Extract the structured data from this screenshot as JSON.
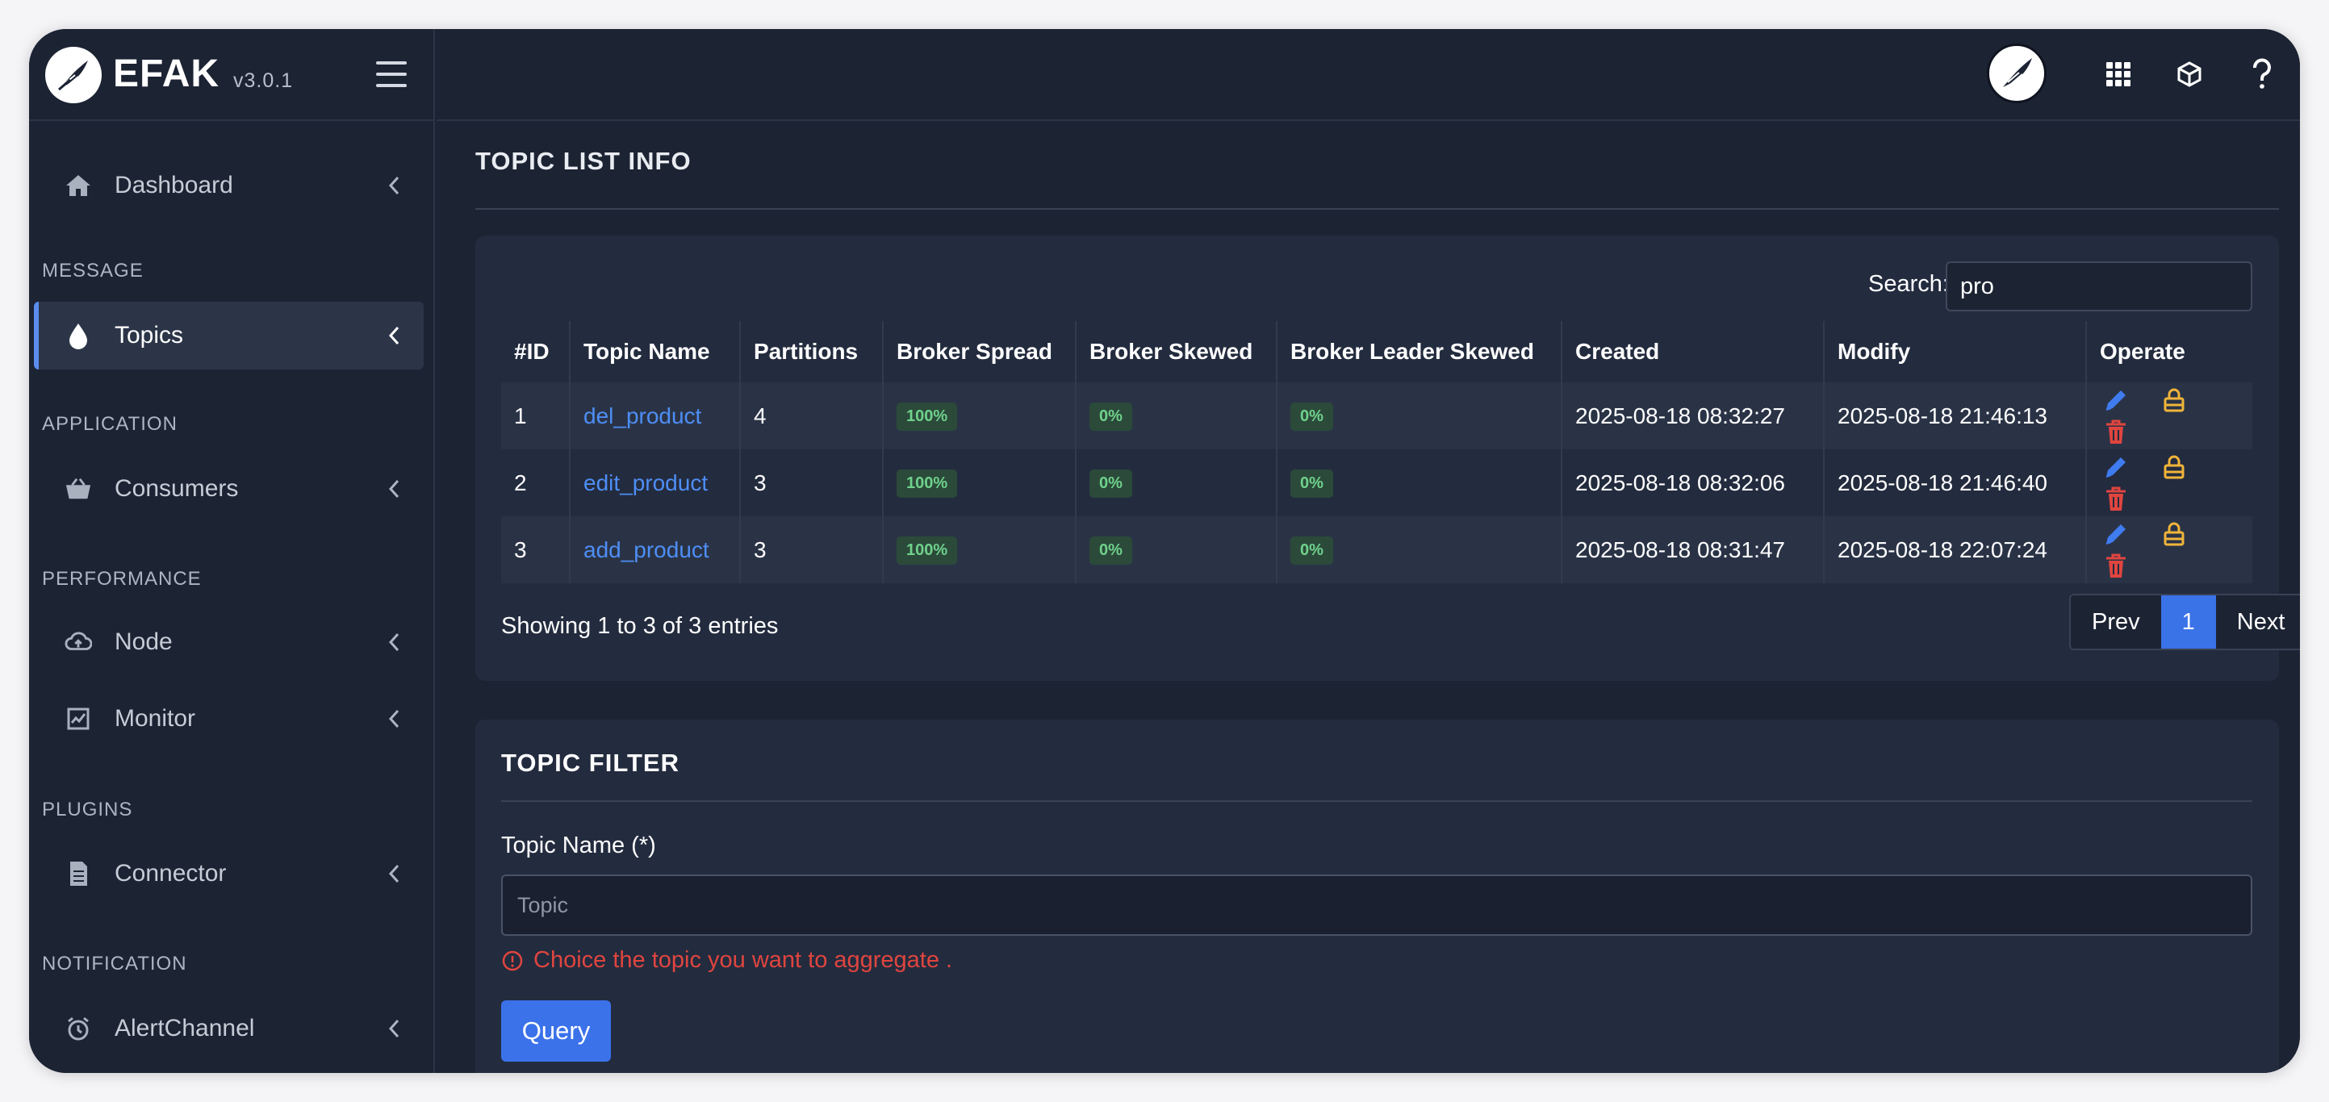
{
  "brand": {
    "name": "EFAK",
    "version": "v3.0.1"
  },
  "sidebar": {
    "sections": [
      "MESSAGE",
      "APPLICATION",
      "PERFORMANCE",
      "PLUGINS",
      "NOTIFICATION"
    ],
    "items": [
      {
        "label": "Dashboard",
        "icon": "home-icon"
      },
      {
        "label": "Topics",
        "icon": "drop-icon",
        "active": true
      },
      {
        "label": "Consumers",
        "icon": "basket-icon"
      },
      {
        "label": "Node",
        "icon": "cloud-icon"
      },
      {
        "label": "Monitor",
        "icon": "chart-icon"
      },
      {
        "label": "Connector",
        "icon": "document-icon"
      },
      {
        "label": "AlertChannel",
        "icon": "alarm-clock-icon"
      }
    ]
  },
  "topbar": {
    "icons": [
      "avatar",
      "apps-grid-icon",
      "cube-icon",
      "help-icon"
    ]
  },
  "page": {
    "title": "TOPIC LIST INFO"
  },
  "search": {
    "label": "Search:",
    "value": "pro"
  },
  "table": {
    "headers": [
      "#ID",
      "Topic Name",
      "Partitions",
      "Broker Spread",
      "Broker Skewed",
      "Broker Leader Skewed",
      "Created",
      "Modify",
      "Operate"
    ],
    "rows": [
      {
        "id": "1",
        "name": "del_product",
        "partitions": "4",
        "spread": "100%",
        "skewed": "0%",
        "leader_skewed": "0%",
        "created": "2025-08-18 08:32:27",
        "modify": "2025-08-18 21:46:13"
      },
      {
        "id": "2",
        "name": "edit_product",
        "partitions": "3",
        "spread": "100%",
        "skewed": "0%",
        "leader_skewed": "0%",
        "created": "2025-08-18 08:32:06",
        "modify": "2025-08-18 21:46:40"
      },
      {
        "id": "3",
        "name": "add_product",
        "partitions": "3",
        "spread": "100%",
        "skewed": "0%",
        "leader_skewed": "0%",
        "created": "2025-08-18 08:31:47",
        "modify": "2025-08-18 22:07:24"
      }
    ],
    "footer": "Showing 1 to 3 of 3 entries",
    "pager": {
      "prev": "Prev",
      "current": "1",
      "next": "Next"
    }
  },
  "filter": {
    "title": "TOPIC FILTER",
    "field_label": "Topic Name (*)",
    "placeholder": "Topic",
    "error": "Choice the topic you want to aggregate .",
    "button": "Query"
  },
  "colors": {
    "bg": "#1c2333",
    "card": "#232b3e",
    "accent": "#3b72ea",
    "link": "#4e8ef5",
    "edit": "#3f7cf0",
    "lock": "#f0b43a",
    "delete": "#e0453f",
    "badge_text": "#6fd18b",
    "error": "#e0453f"
  }
}
